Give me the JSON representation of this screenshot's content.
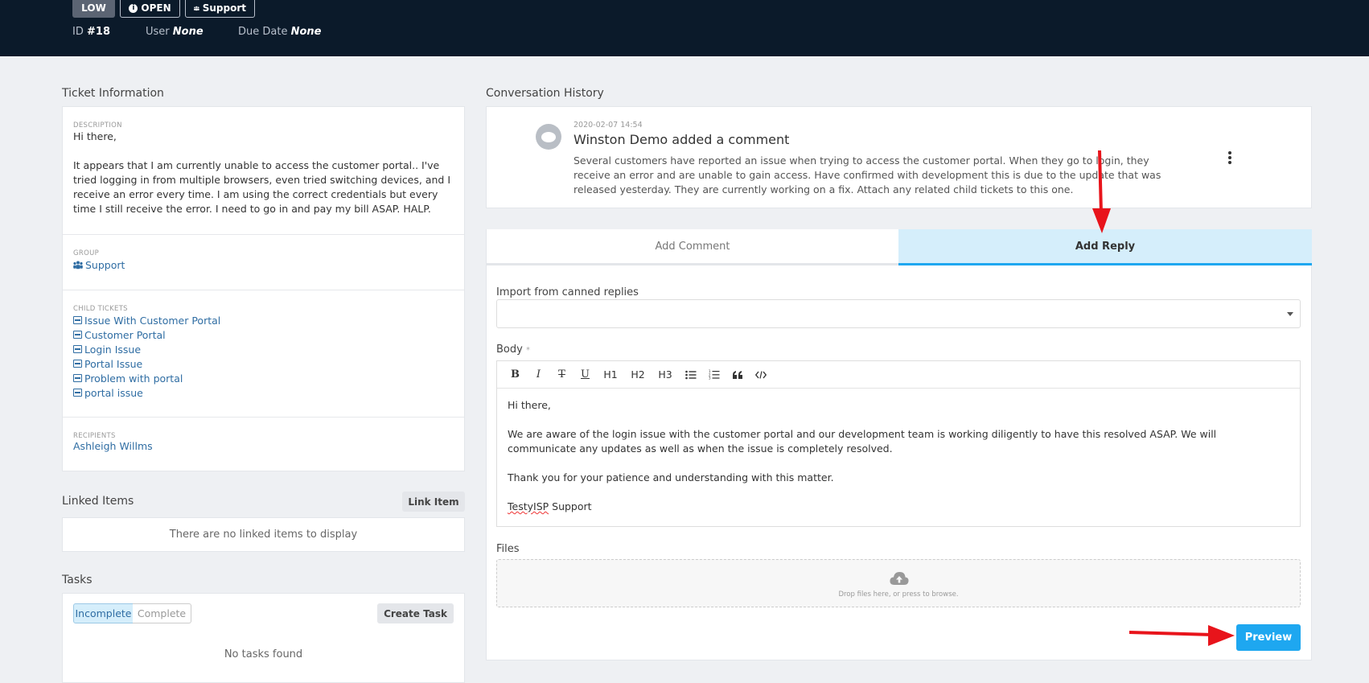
{
  "header": {
    "priority": "LOW",
    "status": "OPEN",
    "group": "Support",
    "id_label": "ID",
    "id_value": "#18",
    "user_label": "User",
    "user_value": "None",
    "due_label": "Due Date",
    "due_value": "None"
  },
  "ticket_info": {
    "title": "Ticket Information",
    "description_label": "DESCRIPTION",
    "description_greeting": "Hi there,",
    "description_body": "It appears that I am currently unable to access the customer portal.. I've tried logging in from multiple browsers, even tried switching devices, and I receive an error every time. I am using the correct credentials but every time I still receive the error. I need to go in and pay my bill ASAP. HALP.",
    "group_label": "GROUP",
    "group_value": "Support",
    "child_tickets_label": "CHILD TICKETS",
    "child_tickets": [
      "Issue With Customer Portal",
      "Customer Portal",
      "Login Issue",
      "Portal Issue",
      "Problem with portal",
      "portal issue"
    ],
    "recipients_label": "RECIPIENTS",
    "recipients_value": "Ashleigh Willms"
  },
  "linked_items": {
    "title": "Linked Items",
    "button": "Link Item",
    "empty": "There are no linked items to display"
  },
  "tasks": {
    "title": "Tasks",
    "filter_incomplete": "Incomplete",
    "filter_complete": "Complete",
    "button": "Create Task",
    "empty": "No tasks found"
  },
  "conversation": {
    "title": "Conversation History",
    "date": "2020-02-07 14:54",
    "headline": "Winston Demo added a comment",
    "body": "Several customers have reported an issue when trying to access the customer portal. When they go to login, they receive an error and are unable to gain access. Have confirmed with development this is due to the update that was released yesterday. They are currently working on a fix. Attach any related child tickets to this one."
  },
  "reply_form": {
    "tab_comment": "Add Comment",
    "tab_reply": "Add Reply",
    "canned_label": "Import from canned replies",
    "canned_value": "",
    "body_label": "Body",
    "required_mark": "*",
    "toolbar": [
      "B",
      "I",
      "T",
      "U",
      "H1",
      "H2",
      "H3",
      "bullet-list",
      "numbered-list",
      "quote",
      "code"
    ],
    "body_line1": "Hi there,",
    "body_line2": "We are aware of the login issue with the customer portal and our development team is working diligently to have this resolved ASAP. We will communicate any updates as well as when the issue is completely resolved.",
    "body_line3": "Thank you for your patience and understanding with this matter.",
    "signature_brand": "TestyISP",
    "signature_rest": " Support",
    "files_label": "Files",
    "dropzone_text": "Drop files here, or press to browse.",
    "preview_button": "Preview"
  },
  "colors": {
    "header_bg": "#0b1a2a",
    "accent": "#1ea7f0",
    "link": "#2f6da3",
    "annotation_arrow": "#e8141b"
  }
}
